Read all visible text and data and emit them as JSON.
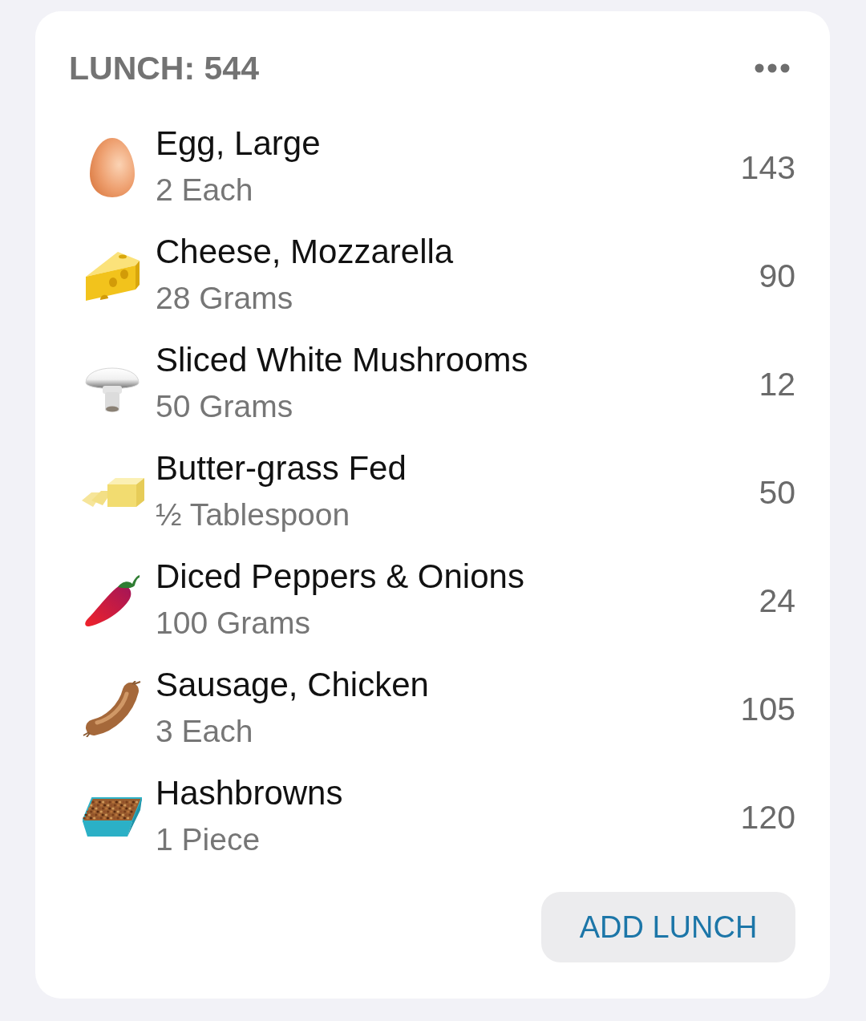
{
  "meal": {
    "title": "LUNCH: 544"
  },
  "items": [
    {
      "name": "Egg, Large",
      "amount": "2 Each",
      "calories": "143"
    },
    {
      "name": "Cheese, Mozzarella",
      "amount": "28 Grams",
      "calories": "90"
    },
    {
      "name": "Sliced White Mushrooms",
      "amount": "50 Grams",
      "calories": "12"
    },
    {
      "name": "Butter-grass Fed",
      "amount": "½ Tablespoon",
      "calories": "50"
    },
    {
      "name": "Diced Peppers & Onions",
      "amount": "100 Grams",
      "calories": "24"
    },
    {
      "name": "Sausage, Chicken",
      "amount": "3 Each",
      "calories": "105"
    },
    {
      "name": "Hashbrowns",
      "amount": "1 Piece",
      "calories": "120"
    }
  ],
  "add_button": {
    "label": "ADD LUNCH"
  }
}
